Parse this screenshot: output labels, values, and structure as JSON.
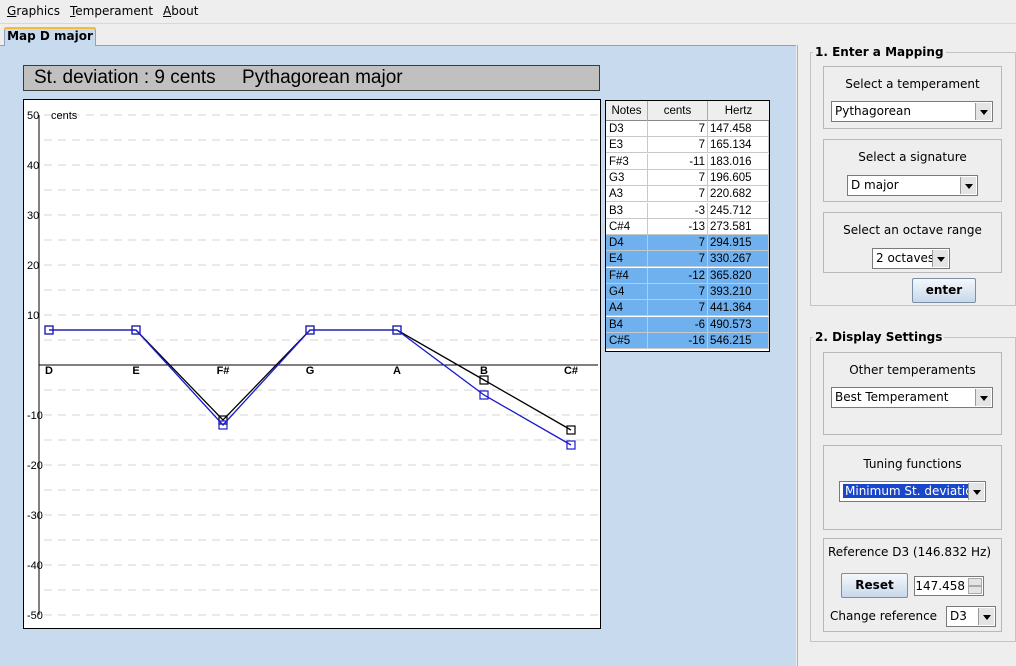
{
  "menu": [
    {
      "mnemonic": "G",
      "rest": "raphics"
    },
    {
      "mnemonic": "T",
      "rest": "emperament"
    },
    {
      "mnemonic": "A",
      "rest": "bout"
    }
  ],
  "tab_label": "Map D major",
  "title": "St. deviation : 9 cents     Pythagorean major",
  "chart_data": {
    "type": "line",
    "ylabel": "cents",
    "ylim": [
      -50,
      50
    ],
    "yticks": [
      "50",
      "40",
      "30",
      "20",
      "10",
      "-10",
      "-20",
      "-30",
      "-40",
      "-50"
    ],
    "categories": [
      "D",
      "E",
      "F#",
      "G",
      "A",
      "B",
      "C#"
    ],
    "series": [
      {
        "color": "#1a1acc",
        "values": [
          7,
          7,
          -12,
          7,
          7,
          -6,
          -16
        ]
      },
      {
        "color": "#000000",
        "values": [
          7,
          7,
          -11,
          7,
          7,
          -3,
          -13
        ]
      }
    ]
  },
  "notes_table": {
    "headers": [
      "Notes",
      "cents",
      "Hertz"
    ],
    "rows": [
      {
        "note": "D3",
        "cents": "7",
        "hertz": "147.458",
        "selected": false
      },
      {
        "note": "E3",
        "cents": "7",
        "hertz": "165.134",
        "selected": false
      },
      {
        "note": "F#3",
        "cents": "-11",
        "hertz": "183.016",
        "selected": false
      },
      {
        "note": "G3",
        "cents": "7",
        "hertz": "196.605",
        "selected": false
      },
      {
        "note": "A3",
        "cents": "7",
        "hertz": "220.682",
        "selected": false
      },
      {
        "note": "B3",
        "cents": "-3",
        "hertz": "245.712",
        "selected": false
      },
      {
        "note": "C#4",
        "cents": "-13",
        "hertz": "273.581",
        "selected": false
      },
      {
        "note": "D4",
        "cents": "7",
        "hertz": "294.915",
        "selected": true
      },
      {
        "note": "E4",
        "cents": "7",
        "hertz": "330.267",
        "selected": true
      },
      {
        "note": "F#4",
        "cents": "-12",
        "hertz": "365.820",
        "selected": true
      },
      {
        "note": "G4",
        "cents": "7",
        "hertz": "393.210",
        "selected": true
      },
      {
        "note": "A4",
        "cents": "7",
        "hertz": "441.364",
        "selected": true
      },
      {
        "note": "B4",
        "cents": "-6",
        "hertz": "490.573",
        "selected": true
      },
      {
        "note": "C#5",
        "cents": "-16",
        "hertz": "546.215",
        "selected": true
      }
    ]
  },
  "mapping": {
    "title": "1. Enter a Mapping",
    "temperament_label": "Select a temperament",
    "temperament_value": "Pythagorean",
    "signature_label": "Select a signature",
    "signature_value": "D major",
    "octave_label": "Select an octave range",
    "octave_value": "2 octaves",
    "enter_label": "enter"
  },
  "display": {
    "title": "2. Display Settings",
    "other_label": "Other temperaments",
    "other_value": "Best Temperament",
    "tuning_label": "Tuning functions",
    "tuning_value": "Minimum St. deviation",
    "reference_label": "Reference D3 (146.832 Hz)",
    "reset_label": "Reset",
    "reference_value": "147.458",
    "change_ref_label": "Change reference",
    "change_ref_value": "D3"
  }
}
